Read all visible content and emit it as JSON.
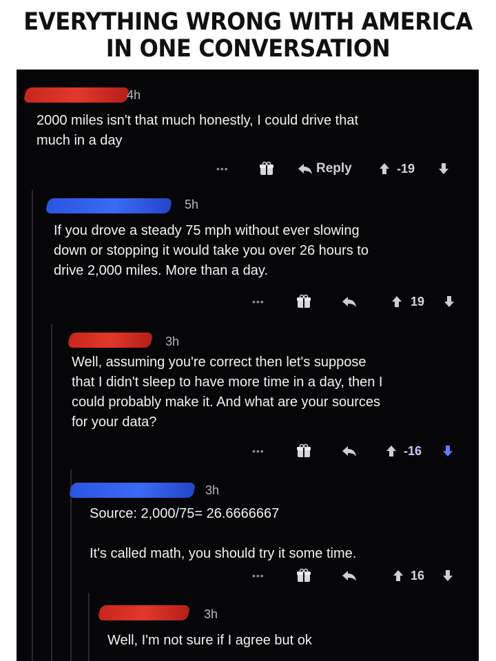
{
  "header": {
    "title": "EVERYTHING WRONG WITH AMERICA IN ONE CONVERSATION"
  },
  "colors": {
    "background": "#060608",
    "text": "#f2f2f2",
    "muted": "#b8b8bc",
    "downvote_active": "#5b7cff",
    "redact_red": "#e2382b",
    "redact_blue": "#3b6af5"
  },
  "comments": [
    {
      "time": "4h",
      "body": "2000 miles isn't that much honestly, I could drive that\nmuch in a day",
      "reply_label": "Reply",
      "score": "-19",
      "icons": [
        "more-icon",
        "gift-icon",
        "reply-icon",
        "upvote-icon",
        "downvote-icon"
      ]
    },
    {
      "time": "5h",
      "body": "If you drove a steady 75 mph without ever slowing\ndown or stopping it would take you over 26 hours to\ndrive 2,000 miles. More than a day.",
      "score": "19"
    },
    {
      "time": "3h",
      "body": "Well, assuming you're correct then let's suppose\nthat I didn't sleep to have more time in a day, then I\ncould probably make it. And what are your sources\nfor your data?",
      "score": "-16"
    },
    {
      "time": "3h",
      "body": "Source: 2,000/75= 26.6666667\n\nIt's called math, you should try it some time.",
      "score": "16"
    },
    {
      "time": "3h",
      "body": "Well, I'm not sure if I agree but ok"
    }
  ]
}
